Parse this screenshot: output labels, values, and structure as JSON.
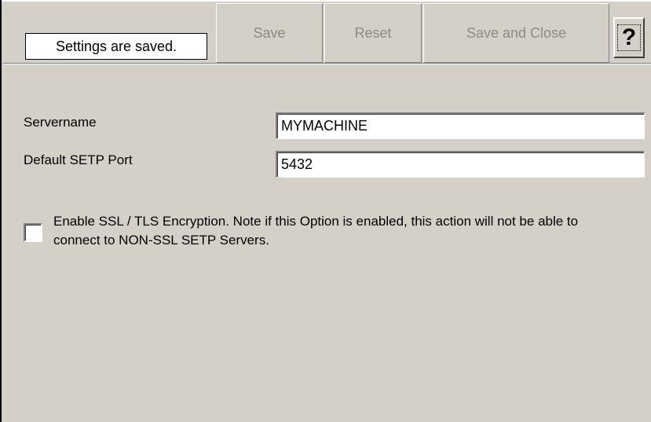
{
  "toolbar": {
    "status_text": "Settings are saved.",
    "save_label": "Save",
    "reset_label": "Reset",
    "save_close_label": "Save and Close",
    "help_label": "?"
  },
  "form": {
    "servername_label": "Servername",
    "servername_value": "MYMACHINE",
    "port_label": "Default SETP Port",
    "port_value": "5432",
    "ssl_checked": false,
    "ssl_label": "Enable SSL / TLS Encryption. Note if this Option is enabled, this action will not be able to connect to NON-SSL SETP Servers."
  },
  "colors": {
    "window_bg": "#d4d0c8",
    "disabled_text": "#8a8a8a"
  }
}
